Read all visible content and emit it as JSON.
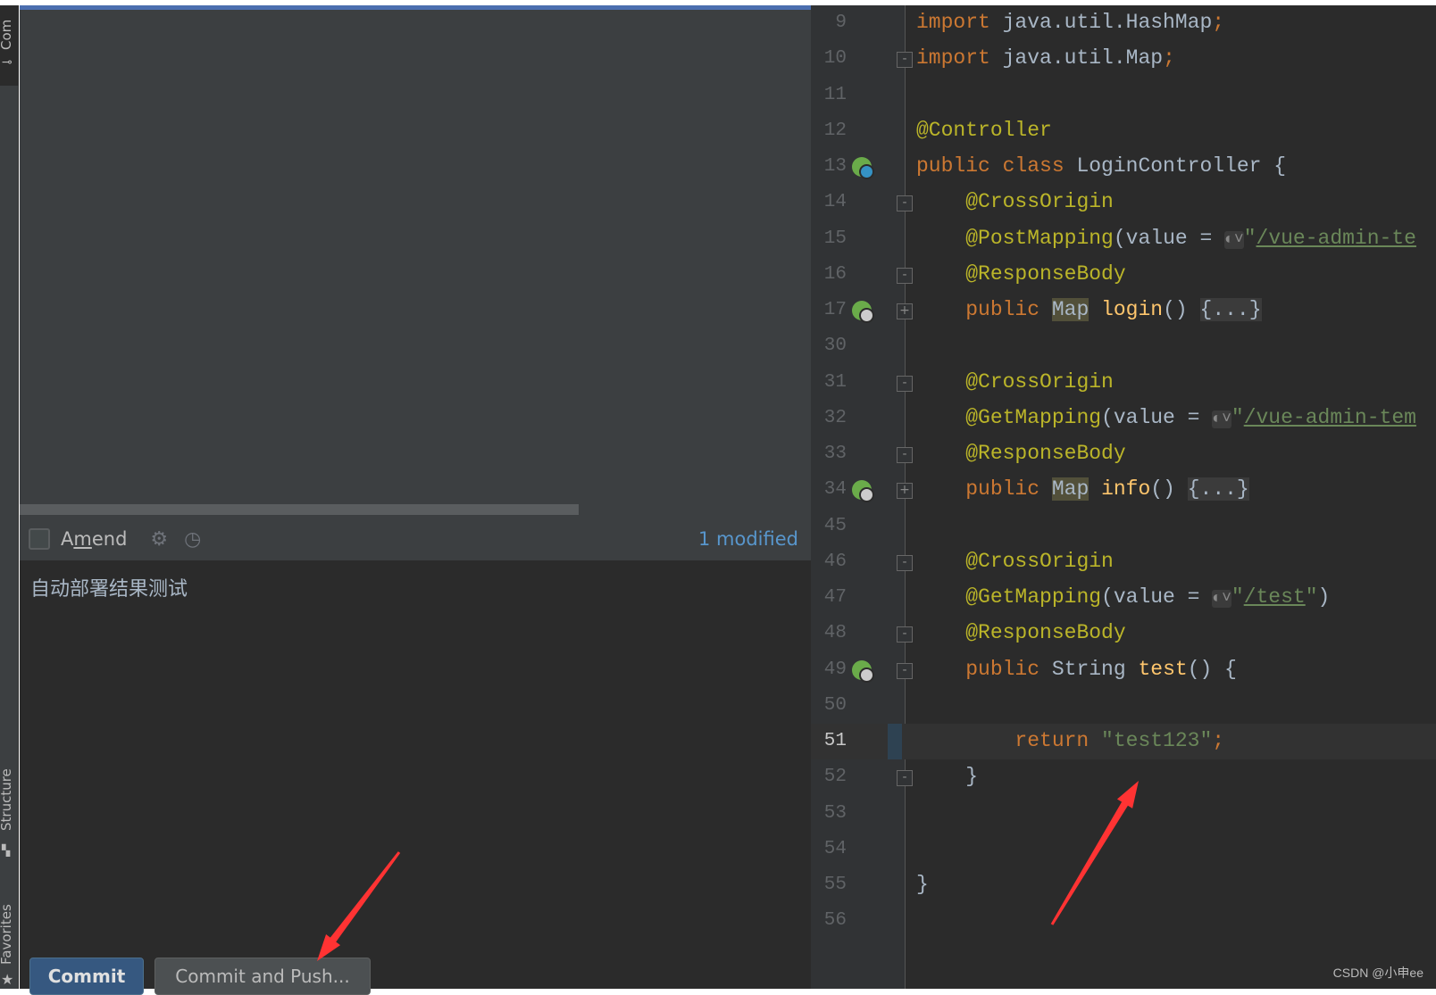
{
  "sidebar": {
    "tabs": [
      {
        "label": "Com"
      },
      {
        "label": "Structure"
      },
      {
        "label": "Favorites"
      }
    ]
  },
  "commit_panel": {
    "amend_label_pre": "A",
    "amend_label_u": "m",
    "amend_label_post": "end",
    "amend_checked": false,
    "modified": "1 modified",
    "message": "自动部署结果测试",
    "commit_button": "Commit",
    "commit_push_button": "Commit and Push..."
  },
  "editor": {
    "current_line": 51,
    "lines": [
      {
        "n": 9,
        "t": [
          [
            "import",
            "kw"
          ],
          [
            " java.util.HashMap",
            ""
          ],
          [
            ";",
            "kw"
          ]
        ]
      },
      {
        "n": 10,
        "fold": "-",
        "t": [
          [
            "import",
            "kw"
          ],
          [
            " java.util.Map",
            ""
          ],
          [
            ";",
            "kw"
          ]
        ]
      },
      {
        "n": 11,
        "t": []
      },
      {
        "n": 12,
        "t": [
          [
            "@Controller",
            "an"
          ]
        ]
      },
      {
        "n": 13,
        "icon": "spring-bean-class-icon",
        "t": [
          [
            "public class ",
            "kw"
          ],
          [
            "LoginController {",
            ""
          ]
        ]
      },
      {
        "n": 14,
        "fold": "-",
        "t": [
          [
            "    ",
            ""
          ],
          [
            "@CrossOrigin",
            "an"
          ]
        ]
      },
      {
        "n": 15,
        "t": [
          [
            "    ",
            ""
          ],
          [
            "@PostMapping",
            "an"
          ],
          [
            "(value = ",
            ""
          ],
          [
            "◐˅",
            "glob"
          ],
          [
            "\"",
            "str"
          ],
          [
            "/vue-admin-te",
            "url"
          ]
        ]
      },
      {
        "n": 16,
        "fold": "-",
        "t": [
          [
            "    ",
            ""
          ],
          [
            "@ResponseBody",
            "an"
          ]
        ]
      },
      {
        "n": 17,
        "icon": "spring-endpoint-icon",
        "fold": "+",
        "t": [
          [
            "    ",
            ""
          ],
          [
            "public ",
            "kw"
          ],
          [
            "Map",
            "hl"
          ],
          [
            " ",
            ""
          ],
          [
            "login",
            "fn"
          ],
          [
            "() ",
            ""
          ],
          [
            "{...}",
            "folded"
          ]
        ]
      },
      {
        "n": 30,
        "t": []
      },
      {
        "n": 31,
        "fold": "-",
        "t": [
          [
            "    ",
            ""
          ],
          [
            "@CrossOrigin",
            "an"
          ]
        ]
      },
      {
        "n": 32,
        "t": [
          [
            "    ",
            ""
          ],
          [
            "@GetMapping",
            "an"
          ],
          [
            "(value = ",
            ""
          ],
          [
            "◐˅",
            "glob"
          ],
          [
            "\"",
            "str"
          ],
          [
            "/vue-admin-tem",
            "url"
          ]
        ]
      },
      {
        "n": 33,
        "fold": "-",
        "t": [
          [
            "    ",
            ""
          ],
          [
            "@ResponseBody",
            "an"
          ]
        ]
      },
      {
        "n": 34,
        "icon": "spring-endpoint-icon",
        "fold": "+",
        "t": [
          [
            "    ",
            ""
          ],
          [
            "public ",
            "kw"
          ],
          [
            "Map",
            "hl"
          ],
          [
            " ",
            ""
          ],
          [
            "info",
            "fn"
          ],
          [
            "() ",
            ""
          ],
          [
            "{...}",
            "folded"
          ]
        ]
      },
      {
        "n": 45,
        "t": []
      },
      {
        "n": 46,
        "fold": "-",
        "t": [
          [
            "    ",
            ""
          ],
          [
            "@CrossOrigin",
            "an"
          ]
        ]
      },
      {
        "n": 47,
        "t": [
          [
            "    ",
            ""
          ],
          [
            "@GetMapping",
            "an"
          ],
          [
            "(value = ",
            ""
          ],
          [
            "◐˅",
            "glob"
          ],
          [
            "\"",
            "str"
          ],
          [
            "/test",
            "url"
          ],
          [
            "\"",
            "str"
          ],
          [
            ")",
            ""
          ]
        ]
      },
      {
        "n": 48,
        "fold": "-",
        "t": [
          [
            "    ",
            ""
          ],
          [
            "@ResponseBody",
            "an"
          ]
        ]
      },
      {
        "n": 49,
        "icon": "spring-endpoint-icon",
        "fold": "-",
        "t": [
          [
            "    ",
            ""
          ],
          [
            "public ",
            "kw"
          ],
          [
            "String ",
            ""
          ],
          [
            "test",
            "fn"
          ],
          [
            "() {",
            ""
          ]
        ]
      },
      {
        "n": 50,
        "t": []
      },
      {
        "n": 51,
        "t": [
          [
            "        ",
            ""
          ],
          [
            "return ",
            "kw"
          ],
          [
            "\"test123\"",
            "str"
          ],
          [
            ";",
            "kw"
          ]
        ]
      },
      {
        "n": 52,
        "fold": "-",
        "t": [
          [
            "    }",
            ""
          ]
        ]
      },
      {
        "n": 53,
        "t": []
      },
      {
        "n": 54,
        "t": []
      },
      {
        "n": 55,
        "t": [
          [
            "}",
            ""
          ]
        ]
      },
      {
        "n": 56,
        "t": []
      }
    ]
  },
  "annotation_color": "#ff3333",
  "watermark": "CSDN @小申ee"
}
